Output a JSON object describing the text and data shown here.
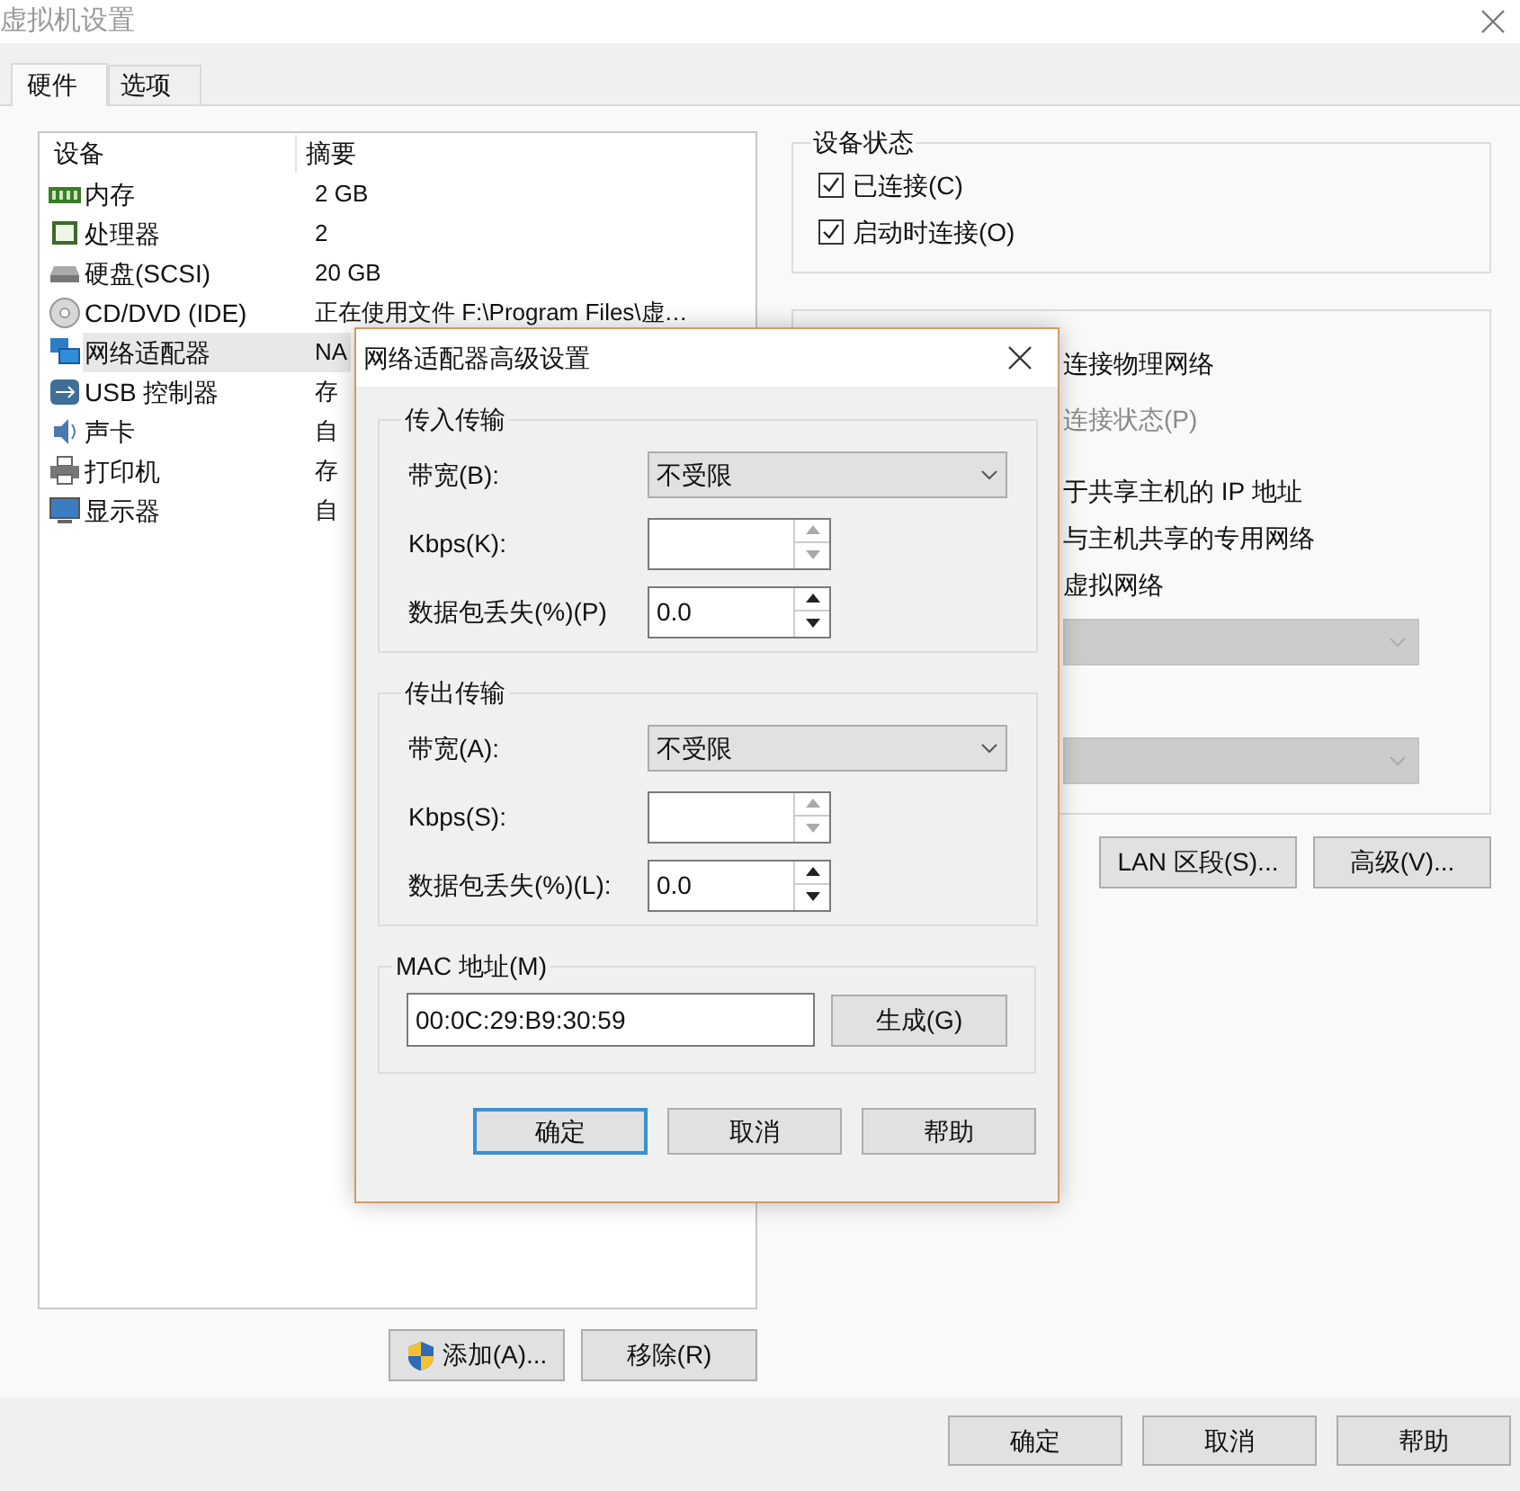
{
  "window": {
    "title": "虚拟机设置"
  },
  "tabs": [
    {
      "label": "硬件",
      "selected": true
    },
    {
      "label": "选项",
      "selected": false
    }
  ],
  "devices": {
    "columns": [
      "设备",
      "摘要"
    ],
    "rows": [
      {
        "kind": "memory",
        "name": "内存",
        "summary": "2 GB",
        "selected": false
      },
      {
        "kind": "cpu",
        "name": "处理器",
        "summary": "2",
        "selected": false
      },
      {
        "kind": "disk",
        "name": "硬盘(SCSI)",
        "summary": "20 GB",
        "selected": false
      },
      {
        "kind": "cd",
        "name": "CD/DVD (IDE)",
        "summary": "正在使用文件 F:\\Program Files\\虚…",
        "selected": false
      },
      {
        "kind": "network",
        "name": "网络适配器",
        "summary": "NA",
        "selected": true
      },
      {
        "kind": "usb",
        "name": "USB 控制器",
        "summary": "存",
        "selected": false
      },
      {
        "kind": "sound",
        "name": "声卡",
        "summary": "自",
        "selected": false
      },
      {
        "kind": "printer",
        "name": "打印机",
        "summary": "存",
        "selected": false
      },
      {
        "kind": "display",
        "name": "显示器",
        "summary": "自",
        "selected": false
      }
    ]
  },
  "list_buttons": [
    {
      "label": "添加(A)...",
      "kind": "shield"
    },
    {
      "label": "移除(R)",
      "kind": "plain"
    }
  ],
  "device_status": {
    "title": "设备状态",
    "options": [
      {
        "label": "已连接(C)",
        "checked": true
      },
      {
        "label": "启动时连接(O)",
        "checked": true
      }
    ]
  },
  "network_connection": {
    "options": [
      {
        "label": "连接物理网络",
        "disabled": false
      },
      {
        "label": "连接状态(P)",
        "disabled": true
      },
      {
        "label": "于共享主机的 IP 地址",
        "disabled": false
      },
      {
        "label": "与主机共享的专用网络",
        "disabled": false
      },
      {
        "label": "虚拟网络",
        "disabled": false
      }
    ],
    "dropdowns": [
      {
        "disabled": true
      },
      {
        "disabled": true
      }
    ]
  },
  "network_buttons": [
    "LAN 区段(S)...",
    "高级(V)..."
  ],
  "footer_buttons": [
    "确定",
    "取消",
    "帮助"
  ],
  "dialog": {
    "title": "网络适配器高级设置",
    "sections": [
      {
        "title": "传入传输",
        "fields": [
          {
            "kind": "select",
            "label": "带宽(B):",
            "value": "不受限"
          },
          {
            "kind": "spin",
            "label": "Kbps(K):",
            "disabled": true
          },
          {
            "kind": "spin",
            "label": "数据包丢失(%)(P)",
            "value": "0.0",
            "disabled": false
          }
        ]
      },
      {
        "title": "传出传输",
        "fields": [
          {
            "kind": "select",
            "label": "带宽(A):",
            "value": "不受限"
          },
          {
            "kind": "spin",
            "label": "Kbps(S):",
            "disabled": true
          },
          {
            "kind": "spin",
            "label": "数据包丢失(%)(L):",
            "value": "0.0",
            "disabled": false
          }
        ]
      }
    ],
    "mac": {
      "title": "MAC 地址(M)",
      "value": "00:0C:29:B9:30:59",
      "button": "生成(G)"
    },
    "buttons": [
      {
        "label": "确定",
        "default": true
      },
      {
        "label": "取消",
        "default": false
      },
      {
        "label": "帮助",
        "default": false
      }
    ]
  }
}
